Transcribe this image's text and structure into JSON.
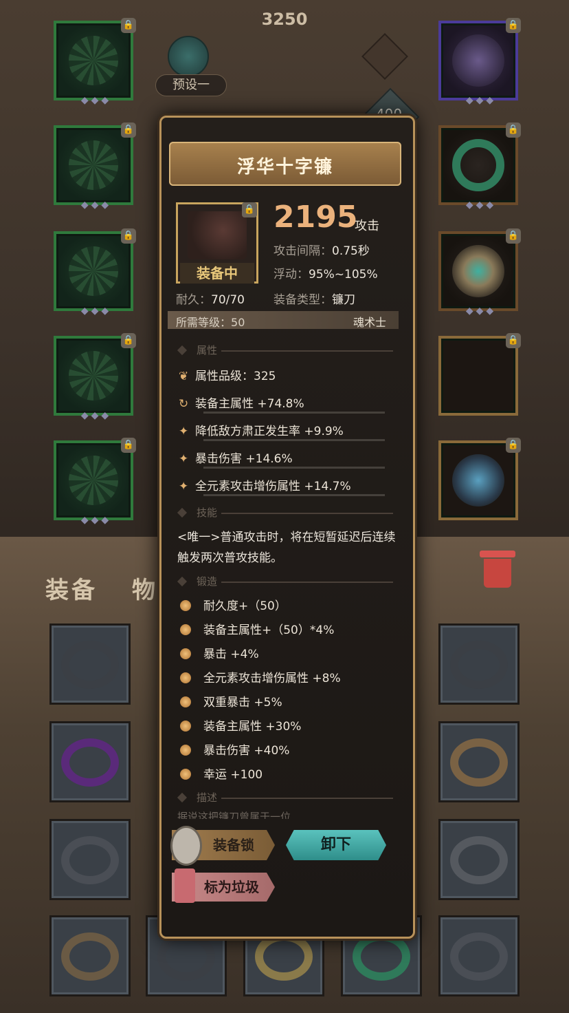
{
  "header": {
    "power": "3250",
    "preset_label": "预设一",
    "cost": "400"
  },
  "tabs": {
    "equipment": "装备",
    "items": "物品"
  },
  "slot_lock_glyph": "🔒",
  "slot_gems": "◆◆◆",
  "item": {
    "name": "浮华十字镰",
    "attack_value": "2195",
    "attack_label": "攻击",
    "status": "装备中",
    "interval_label": "攻击间隔：",
    "interval_value": "0.75秒",
    "float_label": "浮动：",
    "float_value": "95%~105%",
    "durability_label": "耐久：",
    "durability_value": "70/70",
    "type_label": "装备类型：",
    "type_value": "镰刀",
    "level_label": "所需等级：",
    "level_value": "50",
    "class_value": "魂术士"
  },
  "sections": {
    "attributes": "属性",
    "skills": "技能",
    "forge": "锻造",
    "description": "描述"
  },
  "attributes": [
    {
      "icon": "❦",
      "text": "属性品级：325"
    },
    {
      "icon": "↻",
      "text": "装备主属性 +74.8%"
    },
    {
      "icon": "✦",
      "text": "降低敌方肃正发生率 +9.9%"
    },
    {
      "icon": "✦",
      "text": "暴击伤害 +14.6%"
    },
    {
      "icon": "✦",
      "text": "全元素攻击增伤属性 +14.7%"
    }
  ],
  "skill_text": "<唯一>普通攻击时，将在短暂延迟后连续触发两次普攻技能。",
  "forge": [
    "耐久度+（50）",
    "装备主属性+（50）*4%",
    "暴击 +4%",
    "全元素攻击增伤属性 +8%",
    "双重暴击 +5%",
    "装备主属性 +30%",
    "暴击伤害 +40%",
    "幸运 +100"
  ],
  "description_text": "据说这把镰刀曾属于一位……",
  "buttons": {
    "lock": "装备锁",
    "unequip": "卸下",
    "trash": "标为垃圾"
  },
  "colors": {
    "frame_gold": "#b8925a",
    "attack": "#ebb27c",
    "unequip": "#5ac2bd",
    "trash": "#c98a8a"
  }
}
